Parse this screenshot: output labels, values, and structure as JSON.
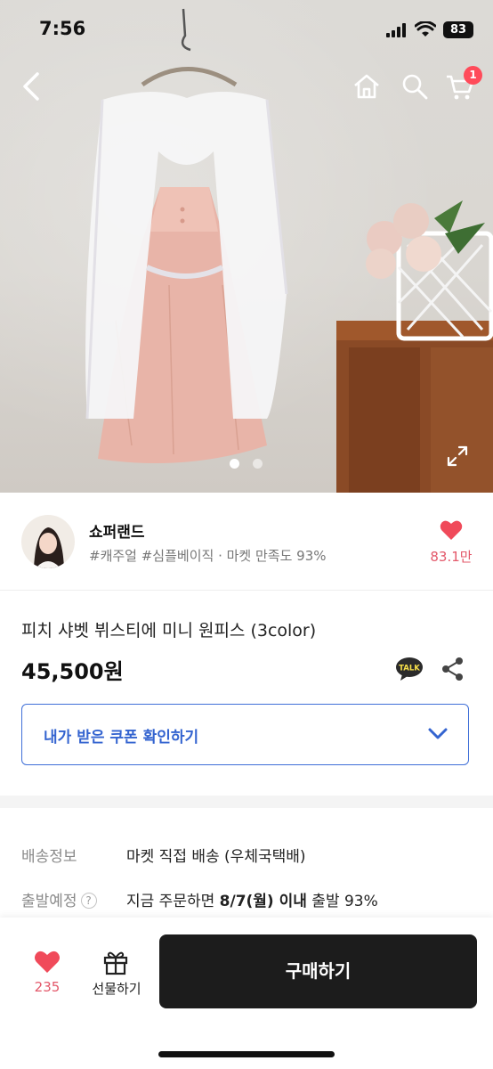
{
  "status_bar": {
    "time": "7:56",
    "battery": "83"
  },
  "nav": {
    "back_icon": "chevron-left-icon",
    "home_icon": "home-icon",
    "search_icon": "search-icon",
    "cart_icon": "cart-icon",
    "cart_badge": "1"
  },
  "gallery": {
    "current_index": 1,
    "total": 2,
    "expand_icon": "expand-icon"
  },
  "shop": {
    "name": "쇼퍼랜드",
    "tags": "#캐주얼 #심플베이직 · 마켓 만족도 93%",
    "likes": "83.1만"
  },
  "product": {
    "title": "피치 샤벳 뷔스티에 미니 원피스 (3color)",
    "price": "45,500원"
  },
  "coupon": {
    "label": "내가 받은 쿠폰 확인하기"
  },
  "shipping": {
    "method_label": "배송정보",
    "method_value": "마켓 직접 배송 (우체국택배)",
    "eta_label": "출발예정",
    "eta_prefix": "지금 주문하면 ",
    "eta_date": "8/7(월) 이내",
    "eta_suffix": " 출발 93%"
  },
  "bottom_bar": {
    "like_count": "235",
    "gift_label": "선물하기",
    "buy_label": "구매하기"
  },
  "colors": {
    "accent_blue": "#3464d0",
    "heart_red": "#ff4b5a",
    "buy_button": "#1c1c1c"
  }
}
